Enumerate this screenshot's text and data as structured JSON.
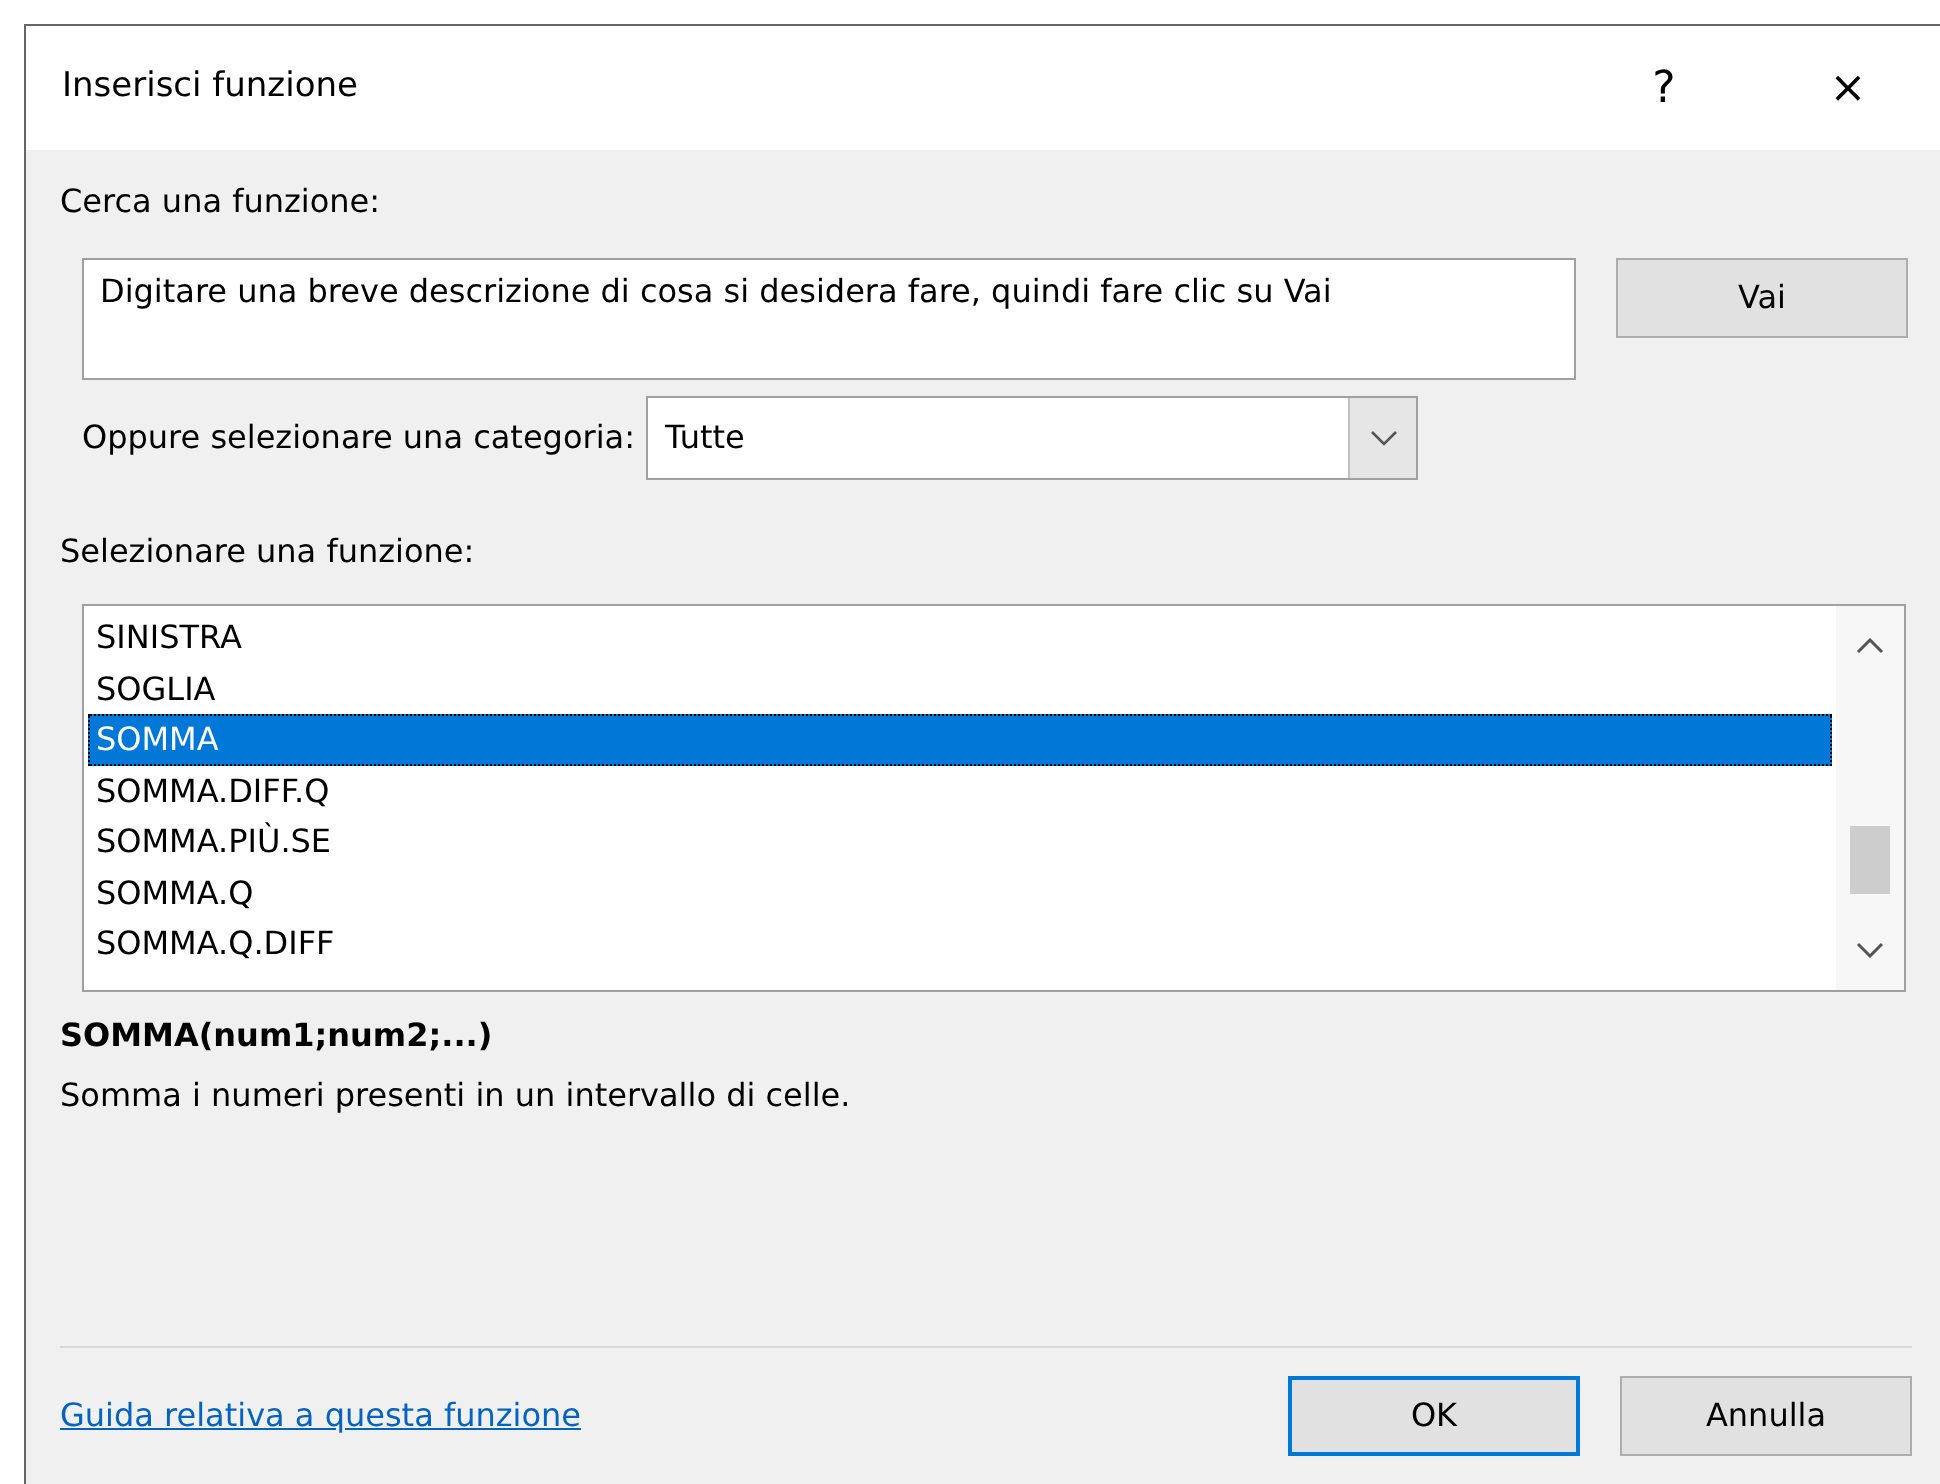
{
  "window": {
    "title": "Inserisci funzione",
    "help": "?",
    "close": "×"
  },
  "search": {
    "label": "Cerca una funzione:",
    "value": "Digitare una breve descrizione di cosa si desidera fare, quindi fare clic su Vai",
    "button": "Vai"
  },
  "category": {
    "label": "Oppure selezionare una categoria:",
    "value": "Tutte"
  },
  "functions": {
    "label": "Selezionare una funzione:",
    "items": [
      {
        "name": "SINISTRA",
        "selected": false
      },
      {
        "name": "SOGLIA",
        "selected": false
      },
      {
        "name": "SOMMA",
        "selected": true
      },
      {
        "name": "SOMMA.DIFF.Q",
        "selected": false
      },
      {
        "name": "SOMMA.PIÙ.SE",
        "selected": false
      },
      {
        "name": "SOMMA.Q",
        "selected": false
      },
      {
        "name": "SOMMA.Q.DIFF",
        "selected": false
      }
    ]
  },
  "signature": "SOMMA(num1;num2;...)",
  "description": "Somma i numeri presenti in un intervallo di celle.",
  "help_link": "Guida relativa a questa funzione",
  "buttons": [
    {
      "label": "OK",
      "default": true
    },
    {
      "label": "Annulla",
      "default": false
    }
  ]
}
